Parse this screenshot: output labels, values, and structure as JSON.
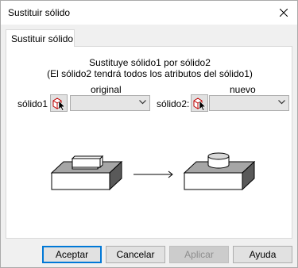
{
  "window": {
    "title": "Sustituir sólido"
  },
  "tab": {
    "label": "Sustituir sólido"
  },
  "description": {
    "line1": "Sustituye sólido1 por sólido2",
    "line2": "(El sólido2 tendrá todos los atributos del sólido1)"
  },
  "original": {
    "column_label": "original",
    "row_label": "sólido1",
    "value": ""
  },
  "nuevo": {
    "column_label": "nuevo",
    "row_label": "sólido2:",
    "value": ""
  },
  "buttons": {
    "accept": "Aceptar",
    "cancel": "Cancelar",
    "apply": "Aplicar",
    "help": "Ayuda"
  },
  "icons": {
    "close": "close-icon",
    "pick": "pick-solid-icon",
    "dropdown": "chevron-down-icon",
    "arrow": "arrow-right-icon"
  }
}
